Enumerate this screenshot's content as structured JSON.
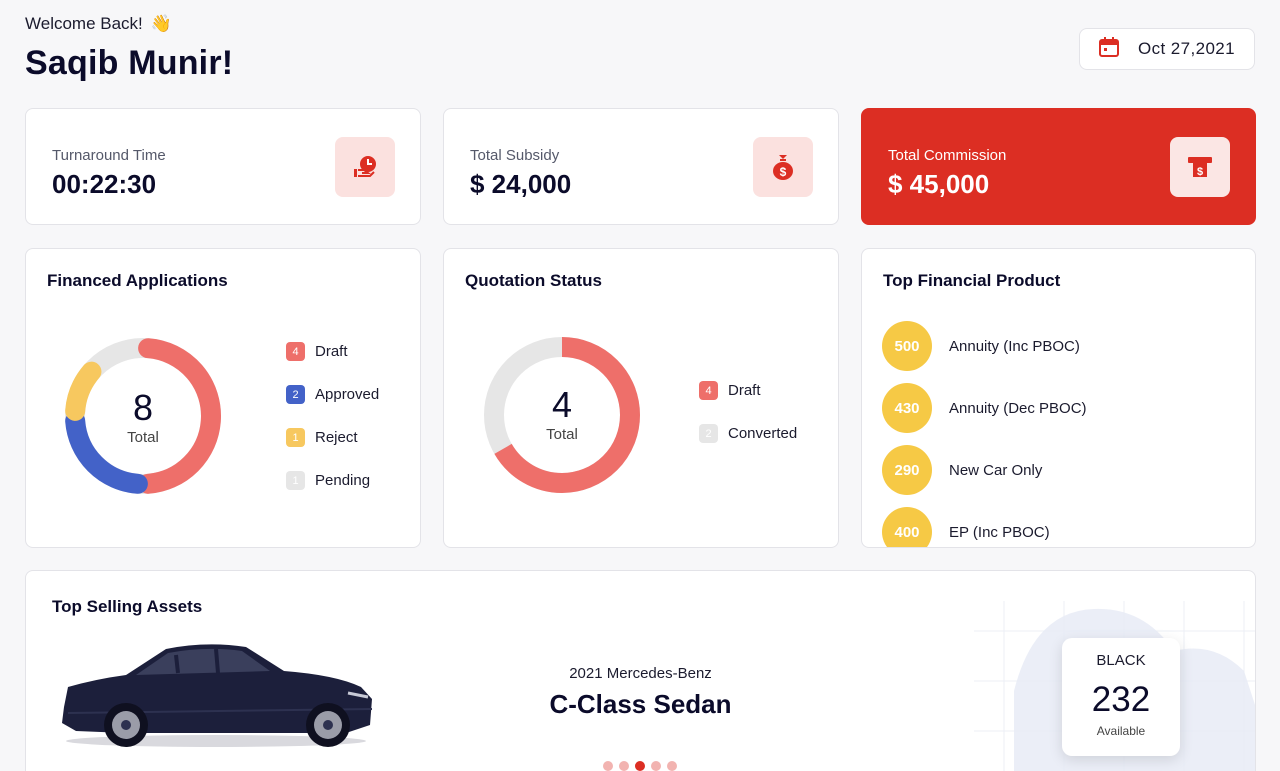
{
  "header": {
    "welcome": "Welcome Back!",
    "wave_emoji": "👋",
    "user_name": "Saqib Munir!",
    "date": "Oct 27,2021",
    "icon": "calendar-icon"
  },
  "kpis": [
    {
      "label": "Turnaround Time",
      "value": "00:22:30",
      "icon": "clock-hand-icon"
    },
    {
      "label": "Total Subsidy",
      "value": "$ 24,000",
      "icon": "money-bag-icon"
    },
    {
      "label": "Total Commission",
      "value": "$ 45,000",
      "icon": "cash-dispense-icon"
    }
  ],
  "financed": {
    "title": "Financed Applications",
    "total": "8",
    "total_label": "Total",
    "legend": [
      {
        "count": "4",
        "label": "Draft",
        "color": "#ee6f6a"
      },
      {
        "count": "2",
        "label": "Approved",
        "color": "#4362c8"
      },
      {
        "count": "1",
        "label": "Reject",
        "color": "#f7c85f"
      },
      {
        "count": "1",
        "label": "Pending",
        "color": "#e6e6e6"
      }
    ]
  },
  "quotation": {
    "title": "Quotation Status",
    "total": "4",
    "total_label": "Total",
    "legend": [
      {
        "count": "4",
        "label": "Draft",
        "color": "#ee6f6a"
      },
      {
        "count": "2",
        "label": "Converted",
        "color": "#e6e6e6"
      }
    ]
  },
  "top_product": {
    "title": "Top Financial Product",
    "items": [
      {
        "value": "500",
        "label": "Annuity (Inc PBOC)"
      },
      {
        "value": "430",
        "label": "Annuity (Dec PBOC)"
      },
      {
        "value": "290",
        "label": "New Car Only"
      },
      {
        "value": "400",
        "label": "EP (Inc PBOC)"
      }
    ]
  },
  "assets": {
    "title": "Top Selling Assets",
    "year_make": "2021 Mercedes-Benz",
    "model": "C-Class Sedan",
    "carousel_active_index": 2,
    "carousel_count": 5,
    "stock": {
      "color": "BLACK",
      "count": "232",
      "label": "Available"
    }
  },
  "colors": {
    "accent": "#dc2e23",
    "draft": "#ee6f6a",
    "approved": "#4362c8",
    "reject": "#f7c85f",
    "pending": "#e6e6e6",
    "product": "#f6c945"
  }
}
